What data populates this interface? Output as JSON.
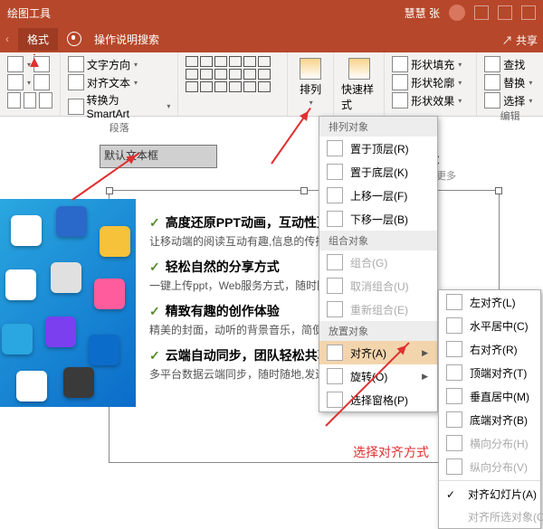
{
  "titlebar": {
    "tool_label": "绘图工具",
    "user": "慧慧 张"
  },
  "tabs": {
    "format": "格式",
    "help": "操作说明搜索"
  },
  "ribbon": {
    "text_dir": "文字方向",
    "align_text": "对齐文本",
    "convert_smartart": "转换为 SmartArt",
    "paragraph_label": "段落",
    "arrange": "排列",
    "quick_styles": "快速样式",
    "shape_fill": "形状填充",
    "shape_outline": "形状轮廓",
    "shape_effects": "形状效果",
    "find": "查找",
    "replace": "替换",
    "select": "选择",
    "edit_label": "编辑"
  },
  "slide": {
    "placeholder": "默认文本框",
    "bigtitle": "课",
    "subtitle": "知之更多",
    "h1": "高度还原PPT动画，互动性更",
    "p1": "让移动端的阅读互动有趣,信息的传播分享",
    "h2": "轻松自然的分享方式",
    "p2": "一键上传ppt，Web服务方式，随时随地",
    "h3": "精致有趣的创作体验",
    "p3": "精美的封面，动听的背景音乐，简便的语音录制，让课件更引",
    "h4": "云端自动同步，团队轻松共享",
    "p4": "多平台数据云端同步，随时随地,发送链接，团队共享，知识"
  },
  "annotation": {
    "align_choice": "选择对齐方式"
  },
  "menu1": {
    "hdr1": "排列对象",
    "top": "置于顶层(R)",
    "bottom": "置于底层(K)",
    "fwd": "上移一层(F)",
    "back": "下移一层(B)",
    "hdr2": "组合对象",
    "group": "组合(G)",
    "ungroup": "取消组合(U)",
    "regroup": "重新组合(E)",
    "hdr3": "放置对象",
    "align": "对齐(A)",
    "rotate": "旋转(O)",
    "pane": "选择窗格(P)"
  },
  "menu2": {
    "left": "左对齐(L)",
    "hcenter": "水平居中(C)",
    "right": "右对齐(R)",
    "top": "顶端对齐(T)",
    "vmid": "垂直居中(M)",
    "bottom": "底端对齐(B)",
    "hdist": "横向分布(H)",
    "vdist": "纵向分布(V)",
    "toslide": "对齐幻灯片(A)",
    "tosel": "对齐所选对象(O)"
  },
  "share": "共享"
}
